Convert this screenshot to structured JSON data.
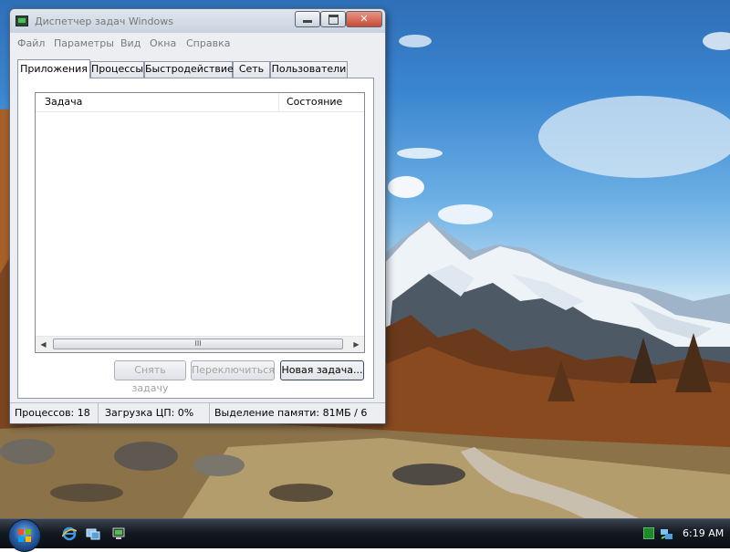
{
  "window": {
    "title": "Диспетчер задач Windows",
    "menu": [
      "Файл",
      "Параметры",
      "Вид",
      "Окна",
      "Справка"
    ],
    "tabs": [
      {
        "label": "Приложения",
        "active": true
      },
      {
        "label": "Процессы",
        "active": false
      },
      {
        "label": "Быстродействие",
        "active": false
      },
      {
        "label": "Сеть",
        "active": false
      },
      {
        "label": "Пользователи",
        "active": false
      }
    ],
    "list": {
      "columns": [
        "Задача",
        "Состояние"
      ],
      "rows": [],
      "scroll_thumb_glyph": "III"
    },
    "buttons": {
      "end_task": "Снять задачу",
      "switch": "Переключиться",
      "new_task": "Новая задача..."
    },
    "status": {
      "processes": "Процессов: 18",
      "cpu": "Загрузка ЦП: 0%",
      "memory": "Выделение памяти: 81МБ / 6"
    }
  },
  "taskbar": {
    "clock": "6:19 AM",
    "quick_launch_icons": [
      "ie-icon",
      "show-desktop-icon",
      "task-manager-icon"
    ],
    "tray_icons": [
      "task-manager-tray-icon",
      "network-tray-icon"
    ]
  },
  "colors": {
    "accent_close": "#c84b33",
    "taskbar": "#141a22",
    "sky": "#3b86d0"
  }
}
